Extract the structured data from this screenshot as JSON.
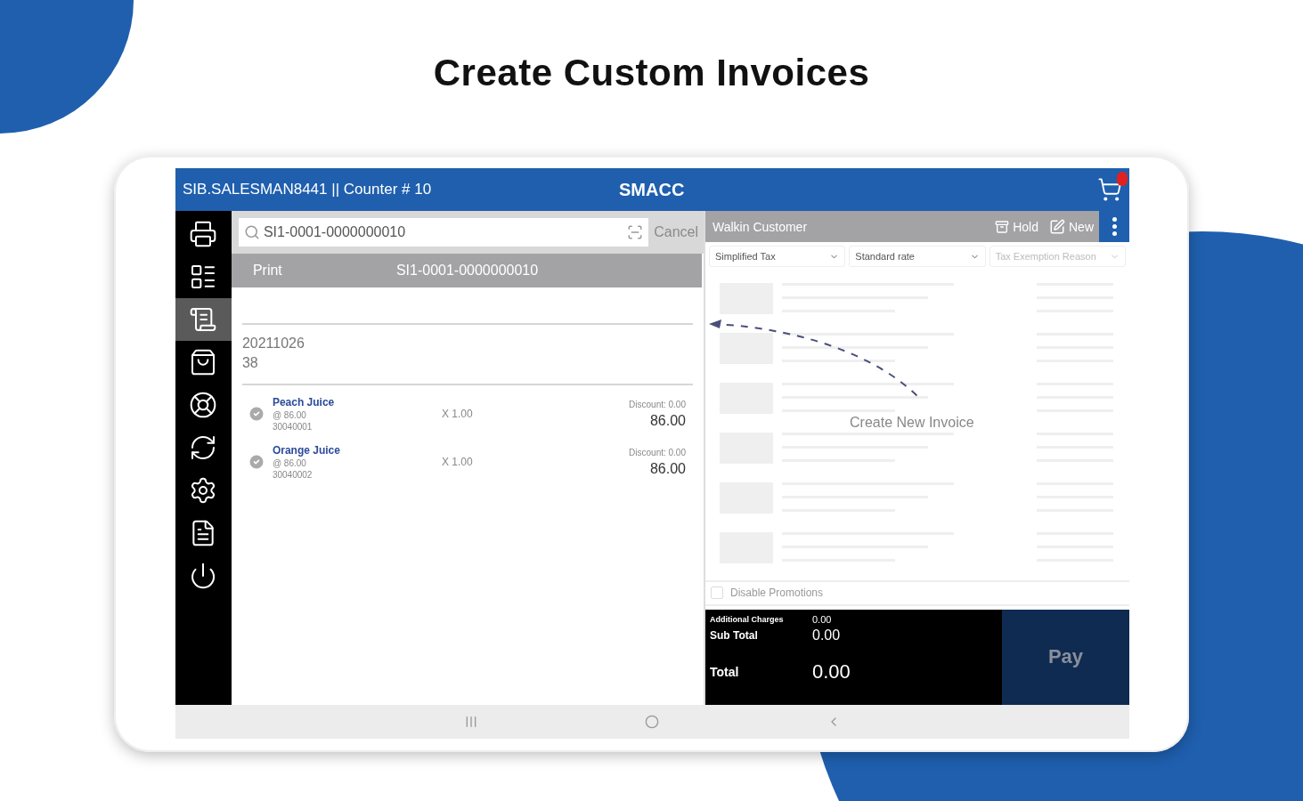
{
  "page_title": "Create Custom Invoices",
  "topbar": {
    "user": "SIB.SALESMAN8441 || Counter  # 10",
    "brand": "SMACC"
  },
  "sidebar": {
    "items": [
      {
        "kind": "register",
        "selected": false
      },
      {
        "kind": "table",
        "selected": false
      },
      {
        "kind": "receipt",
        "selected": true
      },
      {
        "kind": "bag",
        "selected": false
      },
      {
        "kind": "lifebuoy",
        "selected": false
      },
      {
        "kind": "refresh",
        "selected": false
      },
      {
        "kind": "settings",
        "selected": false
      },
      {
        "kind": "document",
        "selected": false
      },
      {
        "kind": "power",
        "selected": false
      }
    ]
  },
  "search": {
    "value": "SI1-0001-0000000010",
    "cancel": "Cancel"
  },
  "print_bar": {
    "action": "Print",
    "invoice": "SI1-0001-0000000010"
  },
  "invoice": {
    "date": "20211026",
    "number": "38"
  },
  "line_items": [
    {
      "name": "Peach Juice",
      "price": "@ 86.00",
      "code": "30040001",
      "quantity": "X 1.00",
      "discount": "Discount: 0.00",
      "amount": "86.00",
      "checked": true
    },
    {
      "name": "Orange Juice",
      "price": "@ 86.00",
      "code": "30040002",
      "quantity": "X 1.00",
      "discount": "Discount: 0.00",
      "amount": "86.00",
      "checked": true
    }
  ],
  "customer_bar": {
    "customer": "Walkin Customer",
    "hold": "Hold",
    "new": "New"
  },
  "dropdowns": [
    {
      "value": "Simplified Tax"
    },
    {
      "value": "Standard rate"
    },
    {
      "placeholder": "Tax Exemption Reason"
    }
  ],
  "hint": "Create New Invoice",
  "promotions": {
    "label": "Disable Promotions",
    "checked": false
  },
  "totals": {
    "additional_label": "Additional Charges",
    "additional_value": "0.00",
    "subtotal_label": "Sub Total",
    "subtotal_value": "0.00",
    "total_label": "Total",
    "total_value": "0.00"
  },
  "pay": "Pay",
  "nav_bar": [
    {
      "kind": "recent"
    },
    {
      "kind": "home"
    },
    {
      "kind": "back"
    }
  ]
}
